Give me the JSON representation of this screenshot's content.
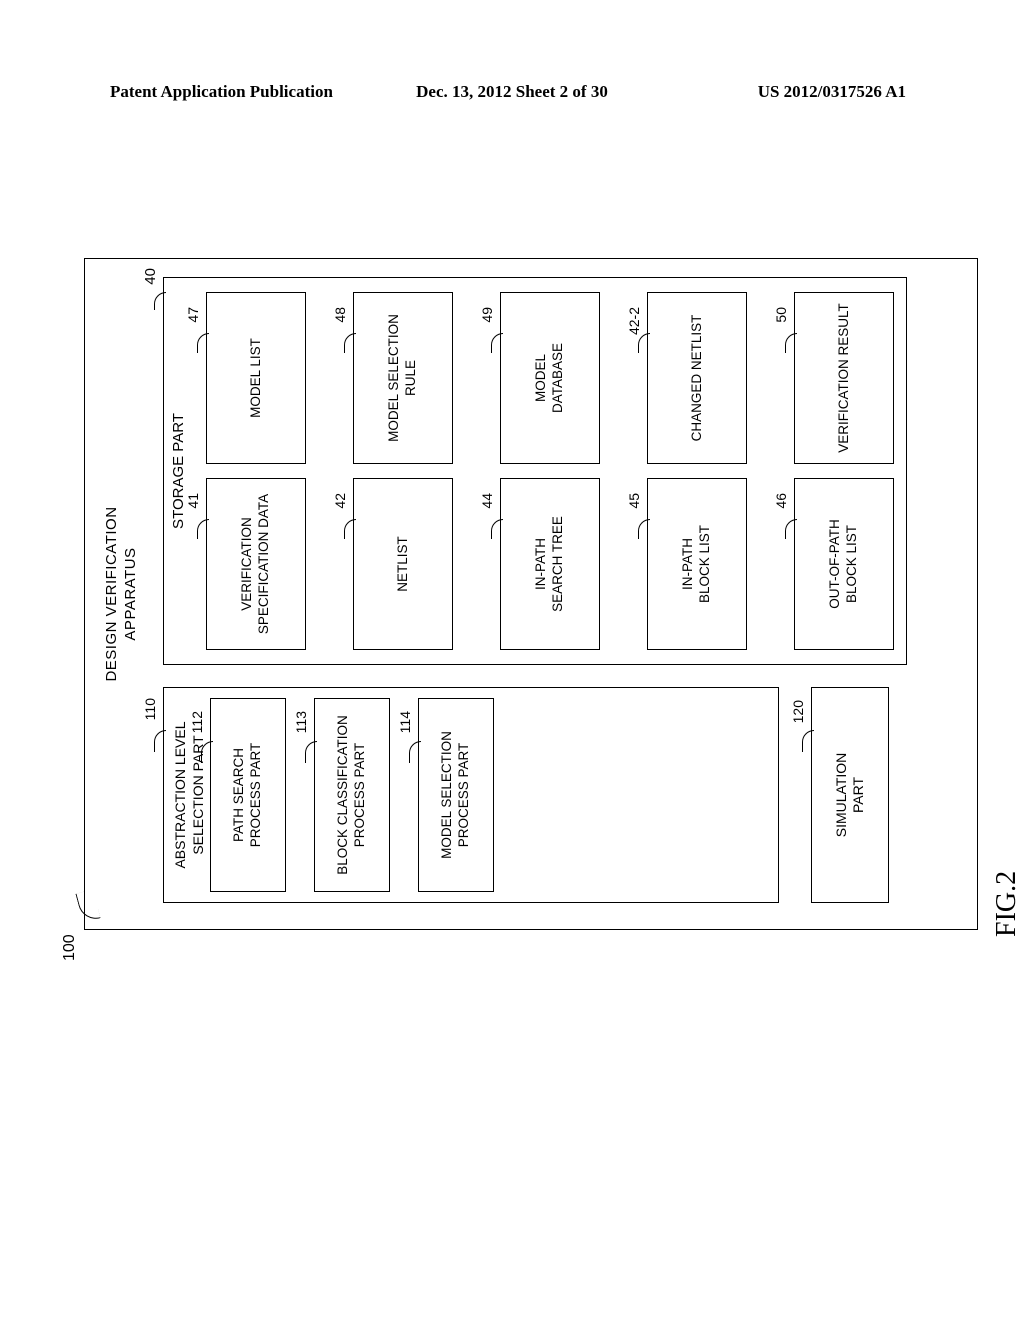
{
  "header": {
    "left": "Patent Application Publication",
    "center": "Dec. 13, 2012  Sheet 2 of 30",
    "right": "US 2012/0317526 A1"
  },
  "figure": {
    "label": "FIG.2",
    "apparatus_ref": "100",
    "apparatus_title_l1": "DESIGN VERIFICATION",
    "apparatus_title_l2": "APPARATUS",
    "selection_group": {
      "ref": "110",
      "title_l1": "ABSTRACTION LEVEL",
      "title_l2": "SELECTION PART",
      "blocks": [
        {
          "ref": "112",
          "l1": "PATH SEARCH",
          "l2": "PROCESS PART"
        },
        {
          "ref": "113",
          "l1": "BLOCK CLASSIFICATION",
          "l2": "PROCESS PART"
        },
        {
          "ref": "114",
          "l1": "MODEL SELECTION",
          "l2": "PROCESS PART"
        }
      ]
    },
    "simulation": {
      "ref": "120",
      "l1": "SIMULATION",
      "l2": "PART"
    },
    "storage": {
      "ref": "40",
      "title": "STORAGE PART",
      "left_col": [
        {
          "ref": "41",
          "l1": "VERIFICATION",
          "l2": "SPECIFICATION DATA"
        },
        {
          "ref": "42",
          "l1": "NETLIST",
          "l2": ""
        },
        {
          "ref": "44",
          "l1": "IN-PATH",
          "l2": "SEARCH TREE"
        },
        {
          "ref": "45",
          "l1": "IN-PATH",
          "l2": "BLOCK LIST"
        },
        {
          "ref": "46",
          "l1": "OUT-OF-PATH",
          "l2": "BLOCK LIST"
        }
      ],
      "right_col": [
        {
          "ref": "47",
          "l1": "MODEL LIST",
          "l2": ""
        },
        {
          "ref": "48",
          "l1": "MODEL SELECTION",
          "l2": "RULE"
        },
        {
          "ref": "49",
          "l1": "MODEL",
          "l2": "DATABASE"
        },
        {
          "ref": "42-2",
          "l1": "CHANGED NETLIST",
          "l2": ""
        },
        {
          "ref": "50",
          "l1": "VERIFICATION RESULT",
          "l2": ""
        }
      ]
    }
  }
}
